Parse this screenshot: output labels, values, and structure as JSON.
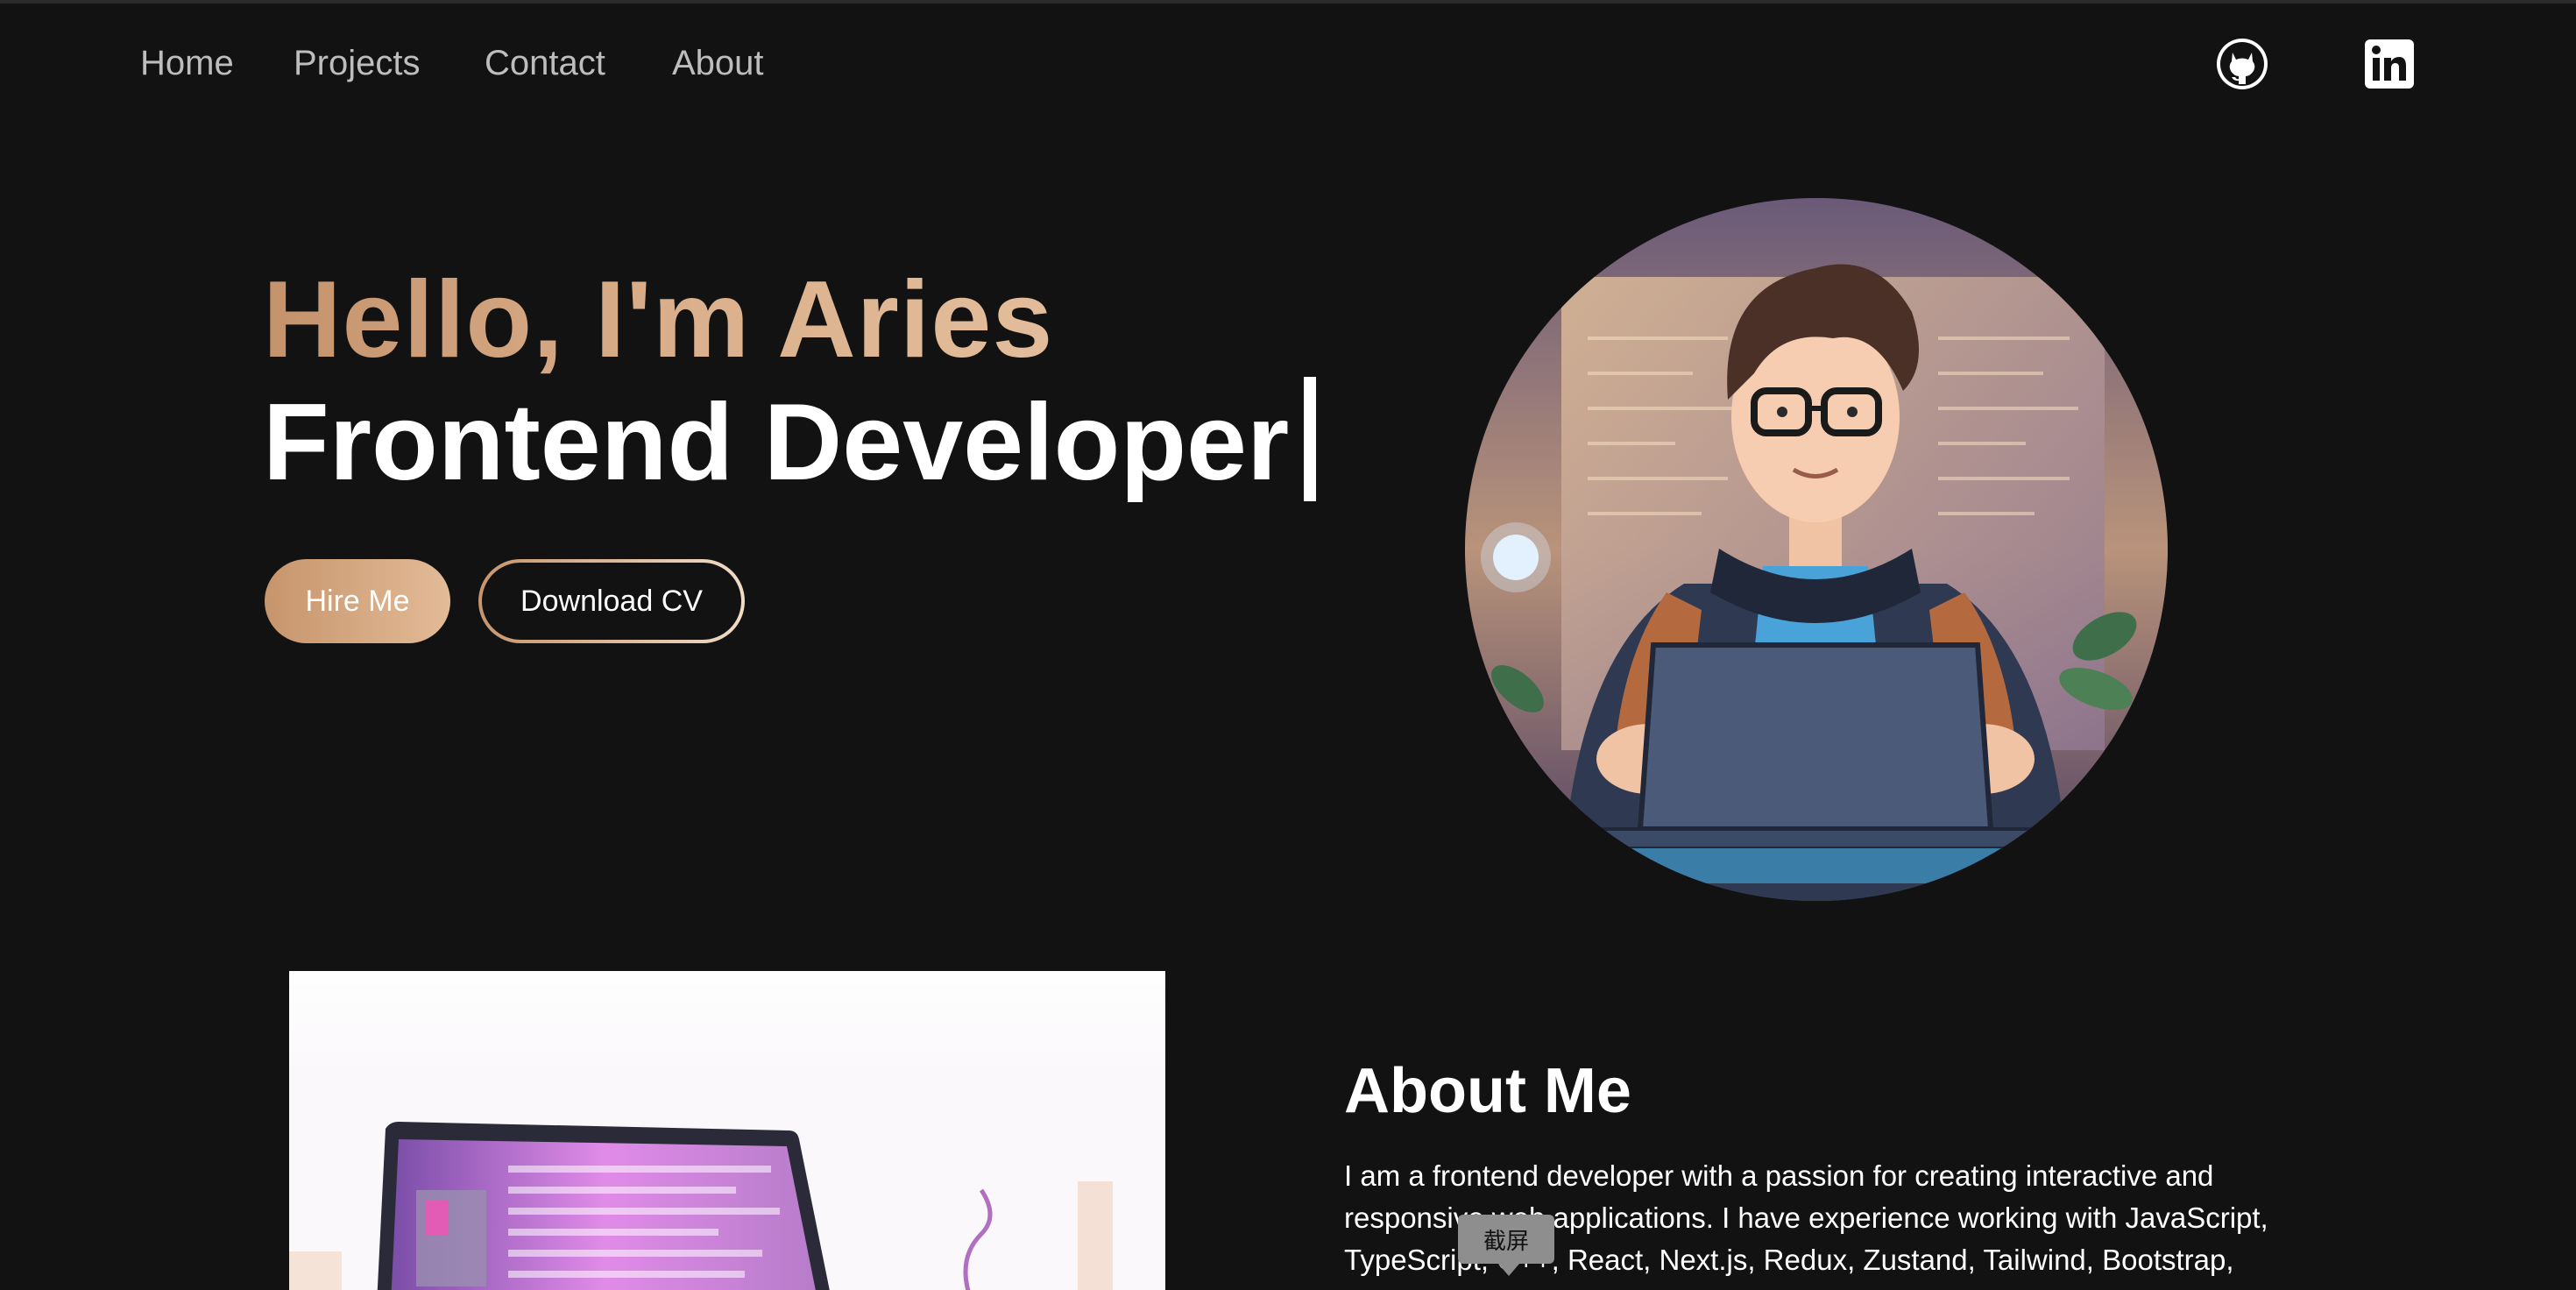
{
  "nav": {
    "links": [
      "Home",
      "Projects",
      "Contact",
      "About"
    ],
    "social": [
      {
        "name": "github-icon"
      },
      {
        "name": "linkedin-icon"
      }
    ]
  },
  "hero": {
    "greeting": "Hello, I'm Aries",
    "role": "Frontend Developer",
    "hire_label": "Hire Me",
    "cv_label": "Download CV"
  },
  "about": {
    "title": "About Me",
    "text": "I am a frontend developer with a passion for creating interactive and responsive web applications. I have experience working with JavaScript, TypeScript, C++, React, Next.js, Redux, Zustand, Tailwind, Bootstrap,"
  },
  "tooltip": {
    "label": "截屏"
  },
  "colors": {
    "background": "#121212",
    "accent_start": "#c4936c",
    "accent_end": "#e3bd9b",
    "nav_text": "#bdbdbd"
  }
}
